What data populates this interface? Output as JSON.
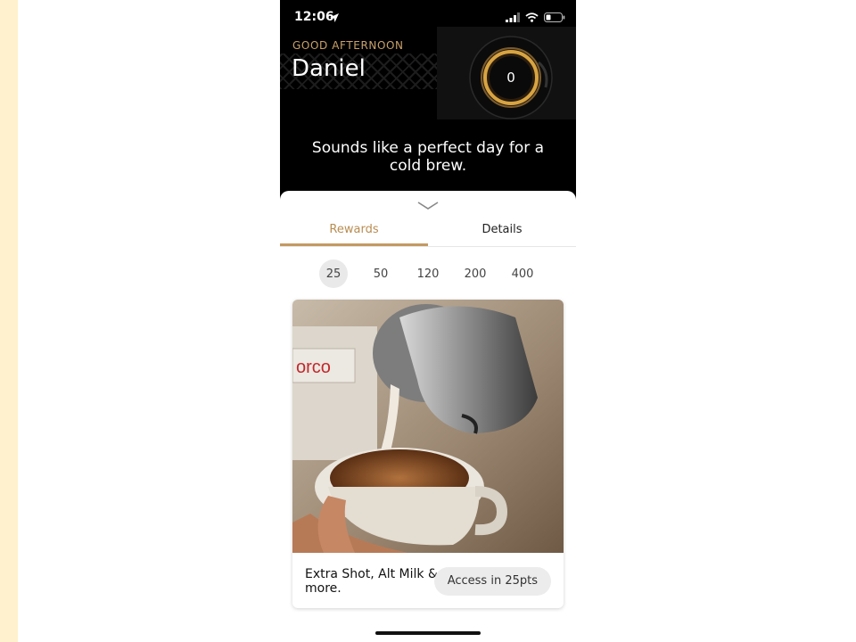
{
  "status_bar": {
    "time": "12:06",
    "icons": [
      "location-arrow-icon",
      "signal-icon",
      "wifi-icon",
      "battery-icon"
    ]
  },
  "header": {
    "greeting": "GOOD AFTERNOON",
    "user_name": "Daniel",
    "points": "0",
    "message": "Sounds like a perfect day for a cold brew."
  },
  "tabs": [
    {
      "label": "Rewards",
      "active": true
    },
    {
      "label": "Details",
      "active": false
    }
  ],
  "tiers": [
    {
      "label": "25",
      "active": true
    },
    {
      "label": "50",
      "active": false
    },
    {
      "label": "120",
      "active": false
    },
    {
      "label": "200",
      "active": false
    },
    {
      "label": "400",
      "active": false
    }
  ],
  "reward_card": {
    "image": "latte-pour-photo",
    "title": "Extra Shot, Alt Milk & more.",
    "button_label": "Access in 25pts"
  },
  "colors": {
    "accent": "#c49a62",
    "header_bg": "#000000",
    "left_strip": "#fff1cd"
  }
}
